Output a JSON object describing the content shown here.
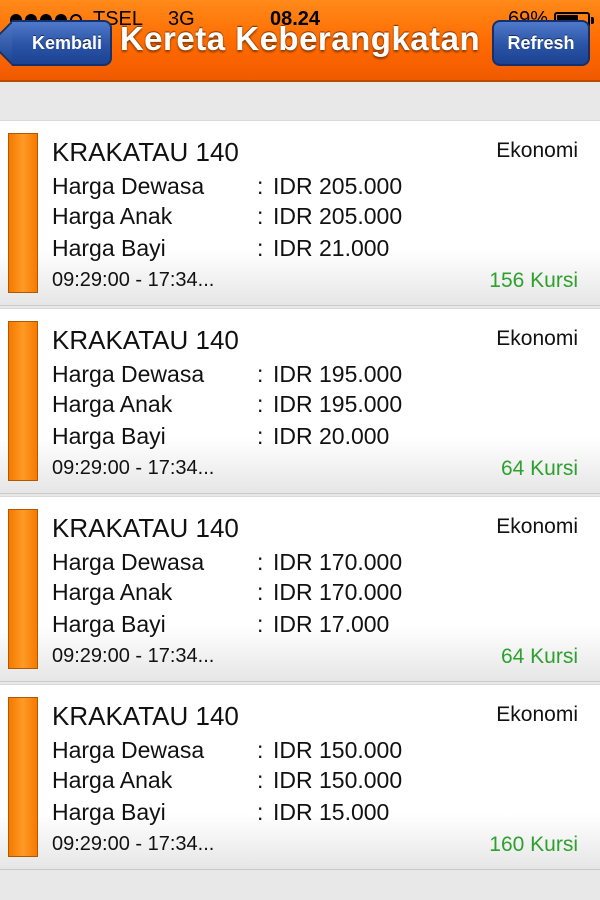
{
  "status_bar": {
    "carrier": "TSEL",
    "network": "3G",
    "time": "08.24",
    "battery": "69%",
    "battery_level": 0.69
  },
  "nav": {
    "back_label": "Kembali",
    "title": "Kereta Keberangkatan",
    "refresh_label": "Refresh"
  },
  "labels": {
    "adult": "Harga Dewasa",
    "child": "Harga Anak",
    "infant": "Harga Bayi",
    "separator": ":"
  },
  "trains": [
    {
      "name": "KRAKATAU 140",
      "class": "Ekonomi",
      "adult_price": "IDR 205.000",
      "child_price": "IDR 205.000",
      "infant_price": "IDR 21.000",
      "time": "09:29:00 - 17:34...",
      "seats": "156 Kursi"
    },
    {
      "name": "KRAKATAU 140",
      "class": "Ekonomi",
      "adult_price": "IDR 195.000",
      "child_price": "IDR 195.000",
      "infant_price": "IDR 20.000",
      "time": "09:29:00 - 17:34...",
      "seats": "64 Kursi"
    },
    {
      "name": "KRAKATAU 140",
      "class": "Ekonomi",
      "adult_price": "IDR 170.000",
      "child_price": "IDR 170.000",
      "infant_price": "IDR 17.000",
      "time": "09:29:00 - 17:34...",
      "seats": "64 Kursi"
    },
    {
      "name": "KRAKATAU 140",
      "class": "Ekonomi",
      "adult_price": "IDR 150.000",
      "child_price": "IDR 150.000",
      "infant_price": "IDR 15.000",
      "time": "09:29:00 - 17:34...",
      "seats": "160 Kursi"
    }
  ],
  "colors": {
    "header": "#ff6a00",
    "button": "#2a53a6",
    "accent_bar": "#f57a00",
    "seats": "#2ea02e"
  }
}
